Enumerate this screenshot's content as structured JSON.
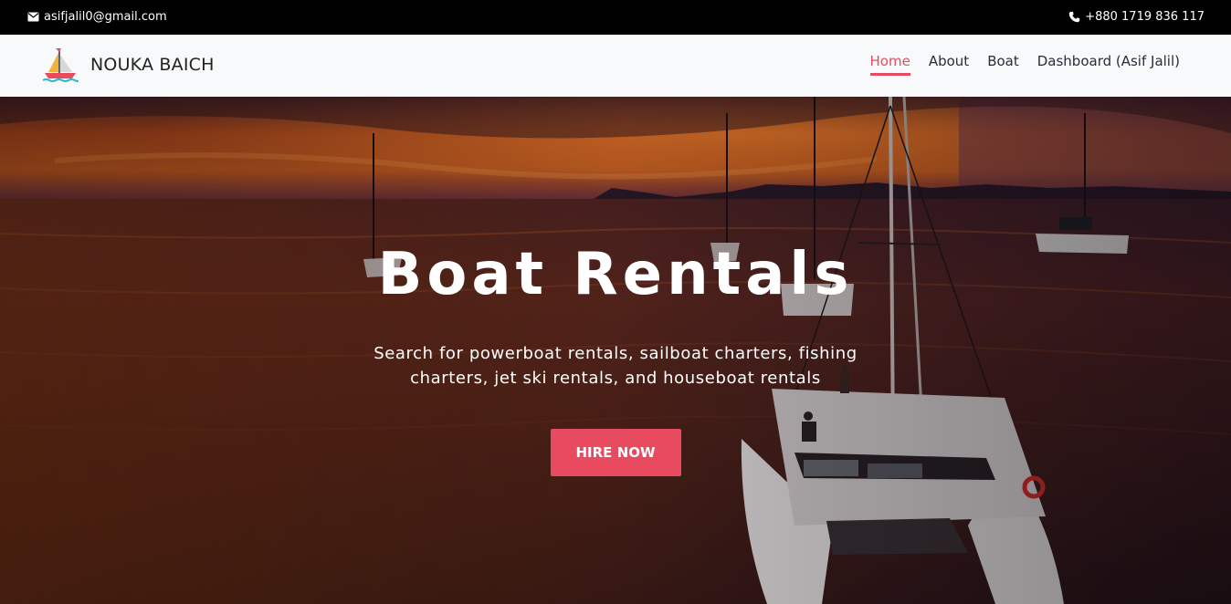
{
  "topbar": {
    "email": "asifjalil0@gmail.com",
    "phone": "+880 1719 836 117"
  },
  "brand": {
    "name": "NOUKA BAICH"
  },
  "nav": {
    "items": [
      {
        "label": "Home",
        "active": true
      },
      {
        "label": "About"
      },
      {
        "label": "Boat"
      },
      {
        "label": "Dashboard (Asif Jalil)"
      }
    ]
  },
  "hero": {
    "title": "Boat Rentals",
    "subtitle": "Search for powerboat rentals, sailboat charters, fishing charters, jet ski rentals, and houseboat rentals",
    "cta": "HIRE NOW"
  },
  "colors": {
    "accent": "#e84a5f",
    "topbar_bg": "#000000",
    "navbar_bg": "#f8f9fa"
  }
}
